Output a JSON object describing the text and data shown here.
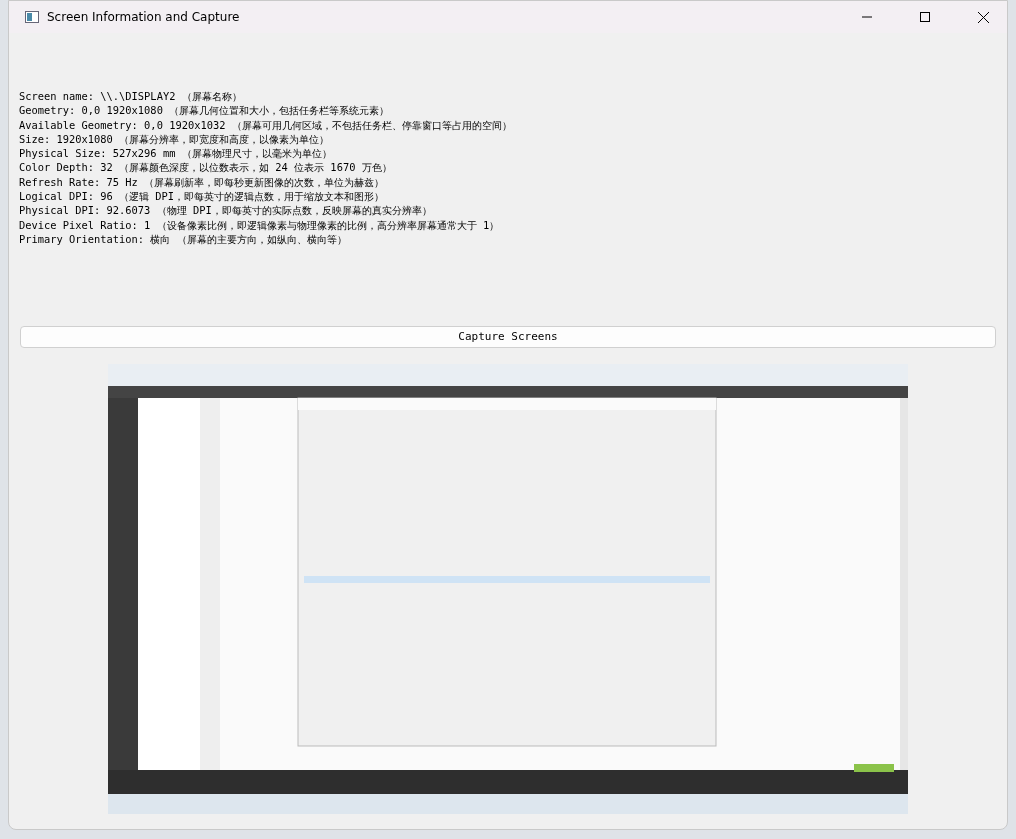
{
  "window": {
    "title": "Screen Information and Capture"
  },
  "info_lines": [
    "Screen name: \\\\.\\DISPLAY2 （屏幕名称）",
    "Geometry: 0,0 1920x1080 （屏幕几何位置和大小，包括任务栏等系统元素）",
    "Available Geometry: 0,0 1920x1032 （屏幕可用几何区域，不包括任务栏、停靠窗口等占用的空间）",
    "Size: 1920x1080 （屏幕分辨率，即宽度和高度，以像素为单位）",
    "Physical Size: 527x296 mm （屏幕物理尺寸，以毫米为单位）",
    "Color Depth: 32 （屏幕颜色深度，以位数表示，如 24 位表示 1670 万色）",
    "Refresh Rate: 75 Hz （屏幕刷新率，即每秒更新图像的次数，单位为赫兹）",
    "Logical DPI: 96 （逻辑 DPI，即每英寸的逻辑点数，用于缩放文本和图形）",
    "Physical DPI: 92.6073 （物理 DPI，即每英寸的实际点数，反映屏幕的真实分辨率）",
    "Device Pixel Ratio: 1 （设备像素比例，即逻辑像素与物理像素的比例，高分辨率屏幕通常大于 1）",
    "Primary Orientation: 横向 （屏幕的主要方向，如纵向、横向等）"
  ],
  "capture_button": {
    "label": "Capture Screens"
  }
}
